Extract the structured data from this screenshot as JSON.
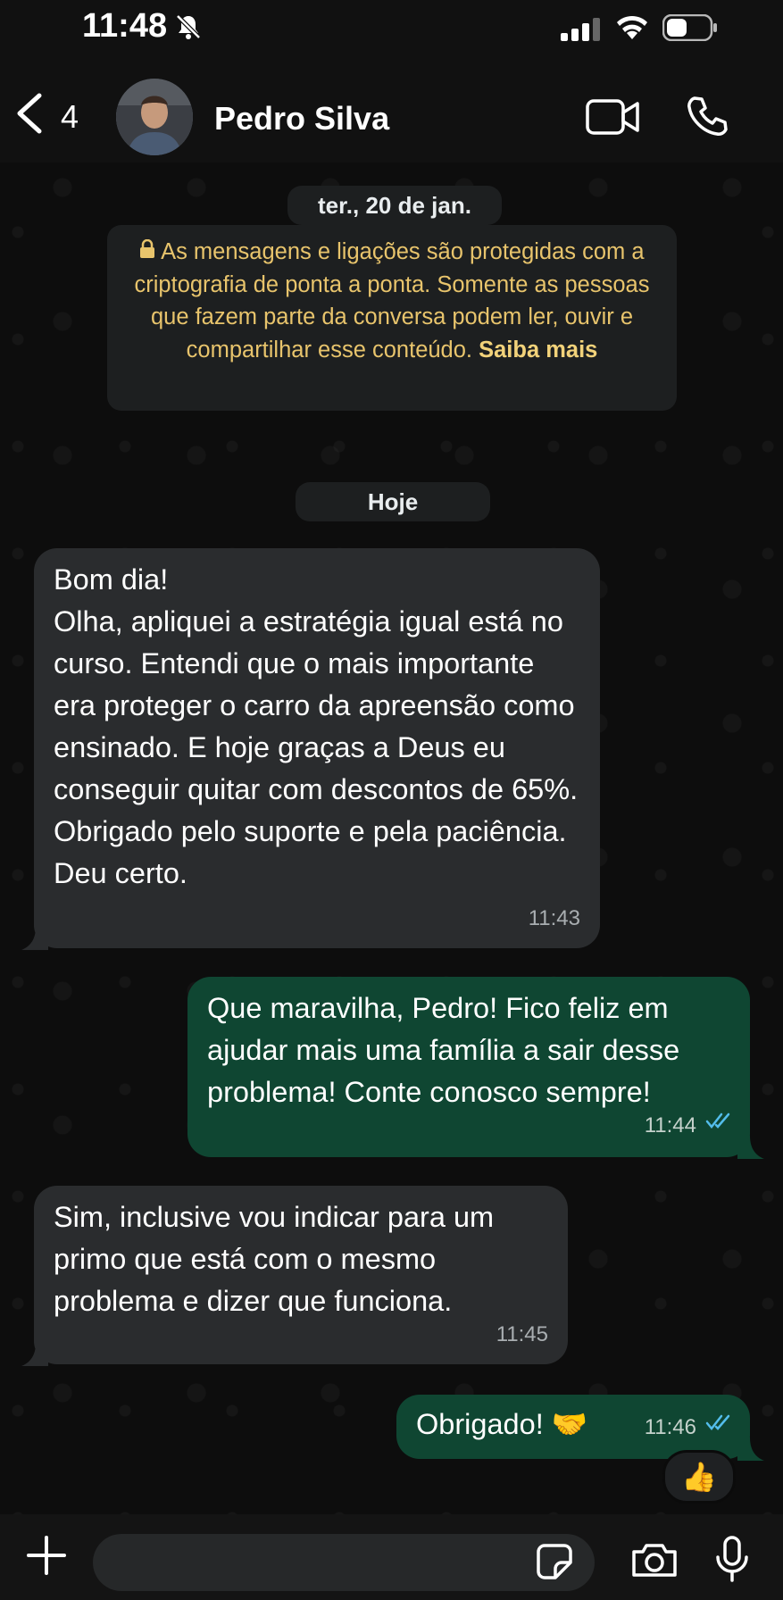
{
  "status_bar": {
    "time": "11:48"
  },
  "header": {
    "unread_count": "4",
    "contact_name": "Pedro Silva"
  },
  "date_separator": "ter., 20 de jan.",
  "encryption_notice": {
    "text": "As mensagens e ligações são protegidas com a criptografia de ponta a ponta. Somente as pessoas que fazem parte da conversa podem ler, ouvir e compartilhar esse conteúdo.",
    "link": "Saiba mais"
  },
  "today_separator": "Hoje",
  "messages": [
    {
      "direction": "incoming",
      "text": "Bom dia!\nOlha, apliquei a estratégia igual está no curso. Entendi que o mais importante era proteger o carro da apreensão como ensinado. E hoje graças a Deus eu conseguir quitar com descontos de 65%. Obrigado pelo suporte e pela paciência. Deu certo.",
      "time": "11:43"
    },
    {
      "direction": "outgoing",
      "text": "Que maravilha, Pedro! Fico feliz em ajudar mais uma família a sair desse problema! Conte conosco sempre!",
      "time": "11:44",
      "status": "read"
    },
    {
      "direction": "incoming",
      "text": "Sim, inclusive vou indicar para um primo que está com o mesmo problema e dizer que funciona.",
      "time": "11:45"
    },
    {
      "direction": "outgoing",
      "text": "Obrigado! 🤝",
      "time": "11:46",
      "status": "read",
      "reaction": "👍"
    }
  ],
  "colors": {
    "incoming_bubble": "#2a2c2e",
    "outgoing_bubble": "#0f4632",
    "read_ticks": "#53bdeb",
    "encryption_text": "#e8c46c"
  },
  "icons": [
    "bell-off-icon",
    "signal-icon",
    "wifi-icon",
    "battery-icon",
    "back-icon",
    "video-call-icon",
    "phone-icon",
    "lock-icon",
    "double-check-icon",
    "plus-icon",
    "sticker-icon",
    "camera-icon",
    "microphone-icon"
  ]
}
